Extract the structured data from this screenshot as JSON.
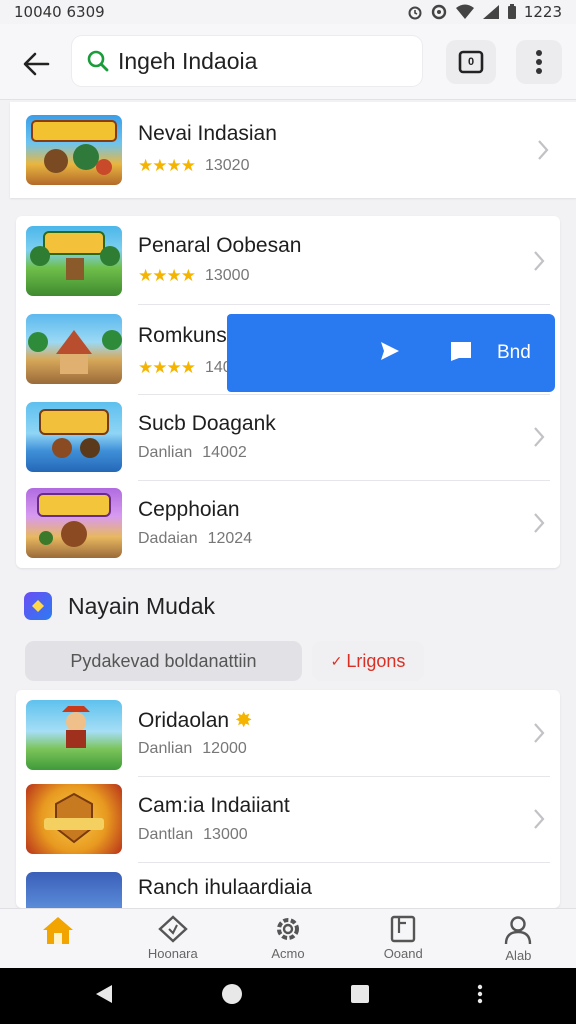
{
  "status_bar": {
    "time": "10040 6309",
    "clock": "1223"
  },
  "search": {
    "query": "Ingeh Indaoia"
  },
  "tabs_count": "0",
  "featured": [
    {
      "title": "Nevai Indasian",
      "stars": "★★★★",
      "count": "13020"
    }
  ],
  "list1": [
    {
      "title": "Penaral Oobesan",
      "stars": "★★★★",
      "count": "13000"
    },
    {
      "title": "Romkunspnenl",
      "stars": "★★★★",
      "count": "14000"
    },
    {
      "title": "Sucb Doagank",
      "meta": "Danlian",
      "count": "14002"
    },
    {
      "title": "Cepphoian",
      "meta": "Dadaian",
      "count": "12024"
    }
  ],
  "action_banner": {
    "label": "Bnd"
  },
  "section": {
    "title": "Nayain Mudak"
  },
  "chips": {
    "primary": "Pydakevad boldanattiin",
    "secondary": "Lrigons"
  },
  "list2": [
    {
      "title": "Oridaolan",
      "meta": "Danlian",
      "count": "12000"
    },
    {
      "title": "Cam:ia Indaiiant",
      "meta": "Dantlan",
      "count": "13000"
    },
    {
      "title": "Ranch ihulaardiaia",
      "meta": "",
      "count": ""
    }
  ],
  "bottom_nav": [
    {
      "label": "",
      "icon": "home-icon"
    },
    {
      "label": "Hoonara",
      "icon": "tag-icon"
    },
    {
      "label": "Acmo",
      "icon": "gear-icon"
    },
    {
      "label": "Ooand",
      "icon": "book-icon"
    },
    {
      "label": "Alab",
      "icon": "person-icon"
    }
  ],
  "colors": {
    "accent_blue": "#2979f0",
    "star": "#f5b400",
    "home_active": "#f2a400",
    "chip_text": "#d93025"
  }
}
